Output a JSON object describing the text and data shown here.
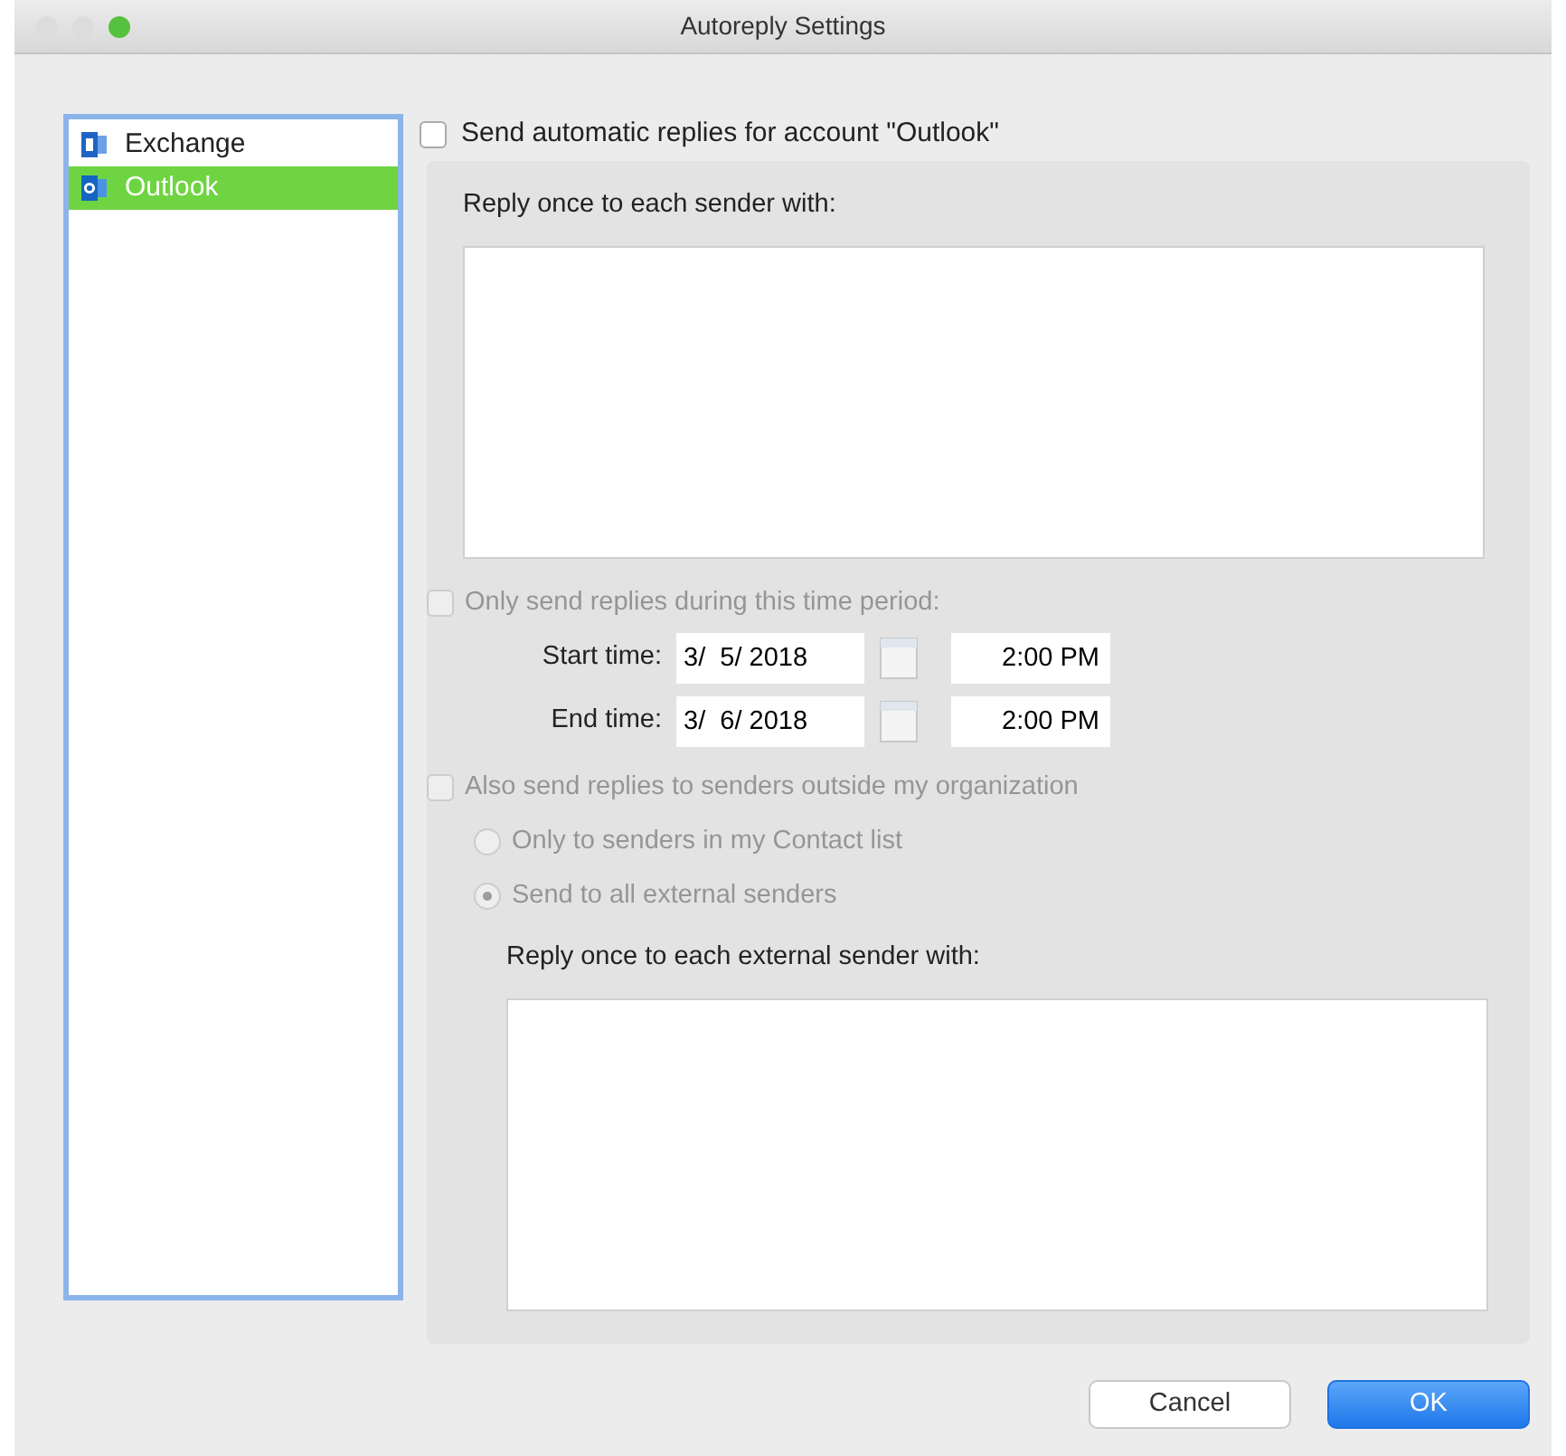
{
  "window": {
    "title": "Autoreply Settings"
  },
  "accounts": [
    {
      "name": "Exchange",
      "kind": "exchange",
      "selected": false
    },
    {
      "name": "Outlook",
      "kind": "outlook",
      "selected": true
    }
  ],
  "send_auto": {
    "label": "Send automatic replies for account \"Outlook\"",
    "checked": false
  },
  "reply_label": "Reply once to each sender with:",
  "time_period": {
    "label": "Only send replies during this time period:",
    "checked": false,
    "disabled": true
  },
  "times": [
    {
      "label": "Start time:",
      "date": "3/  5/ 2018",
      "time": "2:00 PM"
    },
    {
      "label": "End time:",
      "date": "3/  6/ 2018",
      "time": "2:00 PM"
    }
  ],
  "external": {
    "label": "Also send replies to senders outside my organization",
    "checked": false,
    "disabled": true
  },
  "radios": [
    {
      "label": "Only to senders in my Contact list",
      "selected": false,
      "disabled": true
    },
    {
      "label": "Send to all external senders",
      "selected": true,
      "disabled": true
    }
  ],
  "external_label": "Reply once to each external sender with:",
  "buttons": [
    {
      "label": "Cancel",
      "kind": "default"
    },
    {
      "label": "OK",
      "kind": "primary"
    }
  ]
}
